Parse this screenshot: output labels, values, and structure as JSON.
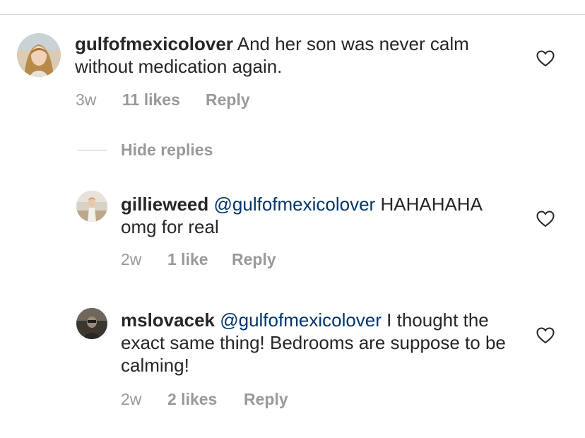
{
  "comments": [
    {
      "username": "gulfofmexicolover",
      "mention": "",
      "text": "And her son was never calm without medication again.",
      "time": "3w",
      "likes": "11 likes",
      "reply": "Reply"
    }
  ],
  "replies_toggle": {
    "label": "Hide replies"
  },
  "replies": [
    {
      "username": "gillieweed",
      "mention": "@gulfofmexicolover",
      "text": "HAHAHAHA omg for real",
      "time": "2w",
      "likes": "1 like",
      "reply": "Reply"
    },
    {
      "username": "mslovacek",
      "mention": "@gulfofmexicolover",
      "text": "I thought the exact same thing! Bedrooms are suppose to be calming!",
      "time": "2w",
      "likes": "2 likes",
      "reply": "Reply"
    }
  ],
  "icons": {
    "like": "heart-icon"
  },
  "colors": {
    "text": "#262626",
    "meta": "#999999",
    "mention": "#003569",
    "divider": "#dbdbdb"
  }
}
